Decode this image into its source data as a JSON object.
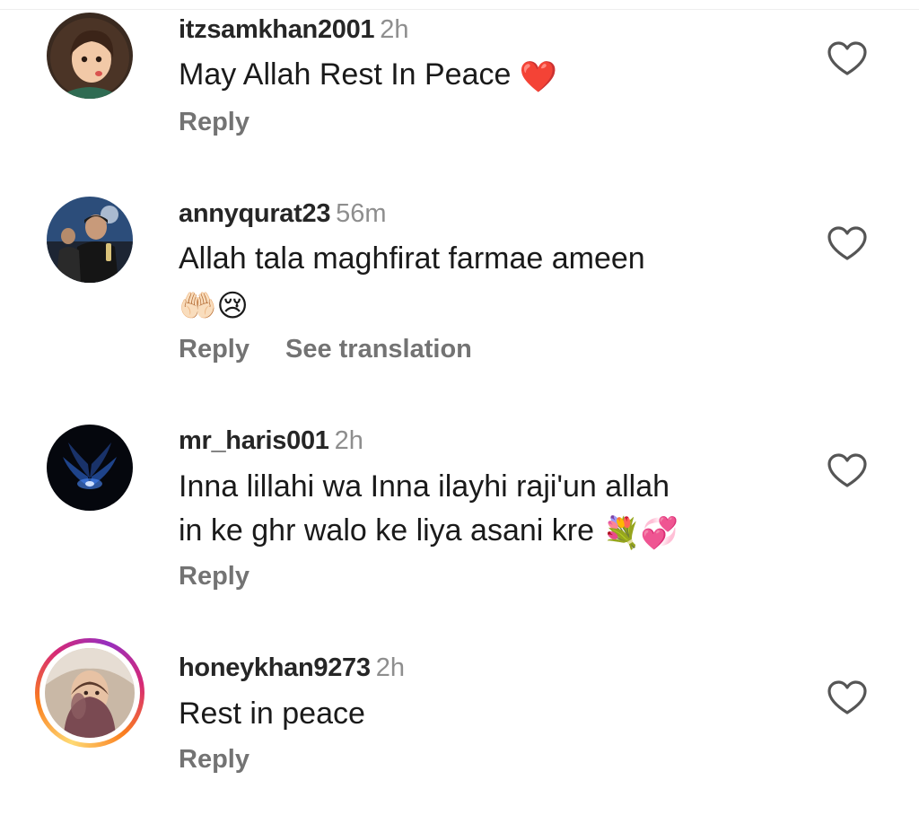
{
  "colors": {
    "username": "#262626",
    "meta": "#8e8e8e",
    "action": "#737373",
    "text": "#1a1a1a",
    "like_heart_red": "#e8233c"
  },
  "comments": [
    {
      "username": "itzsamkhan2001",
      "time": "2h",
      "text_lines": [
        "May Allah Rest In Peace"
      ],
      "emoji_after": "❤️",
      "emoji_icon": "red-heart-icon",
      "actions": [
        "Reply"
      ],
      "avatar": "cartoon-girl-avatar",
      "has_story_ring": false
    },
    {
      "username": "annyqurat23",
      "time": "56m",
      "text_lines": [
        "Allah tala maghfirat farmae ameen"
      ],
      "emoji_line": "🤲🏻😢",
      "emoji_icons": [
        "palms-up-icon",
        "crying-face-icon"
      ],
      "actions": [
        "Reply",
        "See translation"
      ],
      "avatar": "man-with-microphone-avatar",
      "has_story_ring": false
    },
    {
      "username": "mr_haris001",
      "time": "2h",
      "text_lines": [
        "Inna lillahi wa Inna ilayhi raji'un allah",
        "in ke ghr walo ke liya asani kre"
      ],
      "emoji_after": "💐💞",
      "emoji_icons": [
        "bouquet-icon",
        "revolving-hearts-icon"
      ],
      "actions": [
        "Reply"
      ],
      "avatar": "dark-blue-wings-avatar",
      "has_story_ring": false
    },
    {
      "username": "honeykhan9273",
      "time": "2h",
      "text_lines": [
        "Rest in peace"
      ],
      "actions": [
        "Reply"
      ],
      "avatar": "woman-with-scarf-avatar",
      "has_story_ring": true
    }
  ]
}
